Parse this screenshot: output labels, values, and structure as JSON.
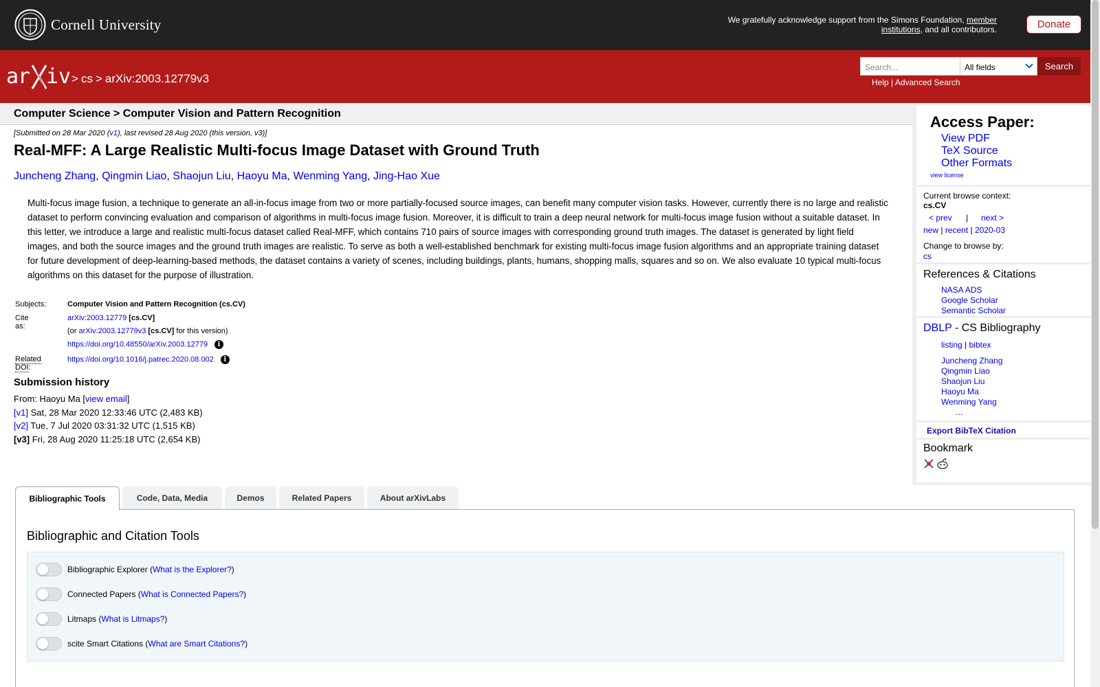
{
  "topbar": {
    "university": "Cornell University",
    "ack_prefix": "We gratefully acknowledge support from the Simons Foundation, ",
    "ack_link": "member institutions",
    "ack_suffix": ", and all contributors.",
    "donate": "Donate"
  },
  "header": {
    "breadcrumb_cs": "cs",
    "breadcrumb_id": "arXiv:2003.12779v3",
    "search_placeholder": "Search...",
    "search_field": "All fields",
    "search_button": "Search",
    "help": "Help",
    "advanced": "Advanced Search"
  },
  "paper": {
    "subject_header": "Computer Science > Computer Vision and Pattern Recognition",
    "date_prefix": "[Submitted on 28 Mar 2020 (",
    "date_v1": "v1",
    "date_suffix": "), last revised 28 Aug 2020 (this version, v3)]",
    "title": "Real-MFF: A Large Realistic Multi-focus Image Dataset with Ground Truth",
    "authors": [
      "Juncheng Zhang",
      "Qingmin Liao",
      "Shaojun Liu",
      "Haoyu Ma",
      "Wenming Yang",
      "Jing-Hao Xue"
    ],
    "abstract": "Multi-focus image fusion, a technique to generate an all-in-focus image from two or more partially-focused source images, can benefit many computer vision tasks. However, currently there is no large and realistic dataset to perform convincing evaluation and comparison of algorithms in multi-focus image fusion. Moreover, it is difficult to train a deep neural network for multi-focus image fusion without a suitable dataset. In this letter, we introduce a large and realistic multi-focus dataset called Real-MFF, which contains 710 pairs of source images with corresponding ground truth images. The dataset is generated by light field images, and both the source images and the ground truth images are realistic. To serve as both a well-established benchmark for existing multi-focus image fusion algorithms and an appropriate training dataset for future development of deep-learning-based methods, the dataset contains a variety of scenes, including buildings, plants, humans, shopping malls, squares and so on. We also evaluate 10 typical multi-focus algorithms on this dataset for the purpose of illustration."
  },
  "meta": {
    "subjects_label": "Subjects:",
    "subjects_value": "Computer Vision and Pattern Recognition (cs.CV)",
    "cite_label": "Cite as:",
    "cite_id": "arXiv:2003.12779",
    "cite_cat": "[cs.CV]",
    "cite_or": "(or ",
    "cite_version_id": "arXiv:2003.12779v3",
    "cite_version_suffix": " for this version)",
    "doi": "https://doi.org/10.48550/arXiv.2003.12779",
    "related_label": "Related DOI",
    "related_doi": "https://doi.org/10.1016/j.patrec.2020.08.002"
  },
  "history": {
    "title": "Submission history",
    "from_prefix": "From: Haoyu Ma [",
    "view_email": "view email",
    "from_suffix": "]",
    "versions": [
      {
        "tag": "[v1]",
        "text": " Sat, 28 Mar 2020 12:33:46 UTC (2,483 KB)"
      },
      {
        "tag": "[v2]",
        "text": " Tue, 7 Jul 2020 03:31:32 UTC (1,515 KB)"
      },
      {
        "tag": "[v3]",
        "text": " Fri, 28 Aug 2020 11:25:18 UTC (2,654 KB)"
      }
    ]
  },
  "sidebar": {
    "access_title": "Access Paper:",
    "view_pdf": "View PDF",
    "tex_source": "TeX Source",
    "other_formats": "Other Formats",
    "view_license": "view license",
    "browse_context_label": "Current browse context:",
    "browse_context": "cs.CV",
    "prev": "< prev",
    "sep": "|",
    "next": "next >",
    "new": "new",
    "recent": "recent",
    "month": "2020-03",
    "change_browse": "Change to browse by:",
    "browse_cs": "cs",
    "refs_title": "References & Citations",
    "nasa": "NASA ADS",
    "google": "Google Scholar",
    "semantic": "Semantic Scholar",
    "dblp": "DBLP",
    "dblp_suffix": " - CS Bibliography",
    "listing": "listing",
    "bibtex": "bibtex",
    "dblp_authors": [
      "Juncheng Zhang",
      "Qingmin Liao",
      "Shaojun Liu",
      "Haoyu Ma",
      "Wenming Yang"
    ],
    "ellipsis": "…",
    "export": "Export BibTeX Citation",
    "bookmark": "Bookmark"
  },
  "tabs": [
    "Bibliographic Tools",
    "Code, Data, Media",
    "Demos",
    "Related Papers",
    "About arXivLabs"
  ],
  "tools": {
    "title": "Bibliographic and Citation Tools",
    "items": [
      {
        "label": "Bibliographic Explorer",
        "link": "What is the Explorer?"
      },
      {
        "label": "Connected Papers",
        "link": "What is Connected Papers?"
      },
      {
        "label": "Litmaps",
        "link": "What is Litmaps?"
      },
      {
        "label": "scite Smart Citations",
        "link": "What are Smart Citations?"
      }
    ]
  },
  "colors": {
    "brand_red": "#b31b1b",
    "topbar": "#222222",
    "link": "#0000ee"
  }
}
